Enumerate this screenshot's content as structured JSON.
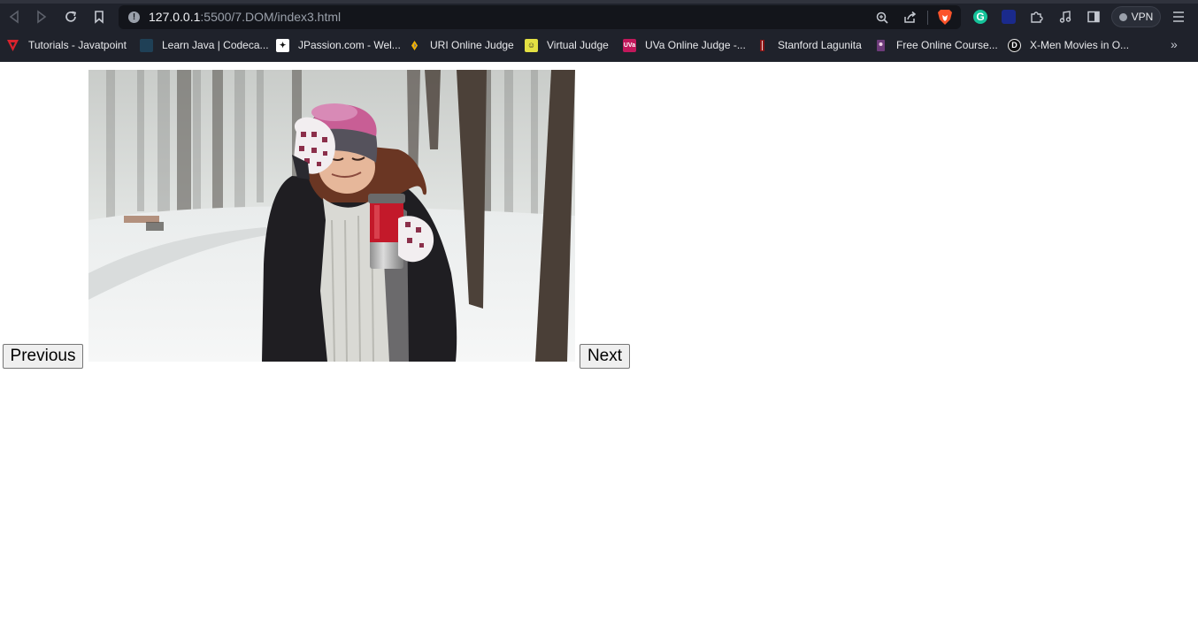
{
  "browser": {
    "url_host": "127.0.0.1",
    "url_path": ":5500/7.DOM/index3.html",
    "vpn_label": "VPN",
    "grammarly_letter": "G",
    "bookmarks": [
      {
        "label": "Tutorials - Javatpoint",
        "icon": "javatpoint-icon",
        "color": "#d9232d"
      },
      {
        "label": "Learn Java | Codeca...",
        "icon": "codecademy-icon",
        "color": "#1f4056"
      },
      {
        "label": "JPassion.com - Wel...",
        "icon": "jpassion-icon",
        "color": "#ffffff"
      },
      {
        "label": "URI Online Judge",
        "icon": "uri-icon",
        "color": "#f2b300"
      },
      {
        "label": "Virtual Judge",
        "icon": "vjudge-icon",
        "color": "#e3e043"
      },
      {
        "label": "UVa Online Judge -...",
        "icon": "uva-icon",
        "color": "#c2185b"
      },
      {
        "label": "Stanford Lagunita",
        "icon": "stanford-icon",
        "color": "#8c1515"
      },
      {
        "label": "Free Online Course...",
        "icon": "coursera-icon",
        "color": "#6d3b7a"
      },
      {
        "label": "X-Men Movies in O...",
        "icon": "dmovies-icon",
        "color": "#111111"
      }
    ],
    "uva_badge": "UVa",
    "d_badge": "D"
  },
  "page": {
    "previous_label": "Previous",
    "next_label": "Next"
  },
  "colors": {
    "chrome_bg": "#1f222b",
    "url_bg": "#13151b",
    "page_bg": "#ffffff"
  }
}
